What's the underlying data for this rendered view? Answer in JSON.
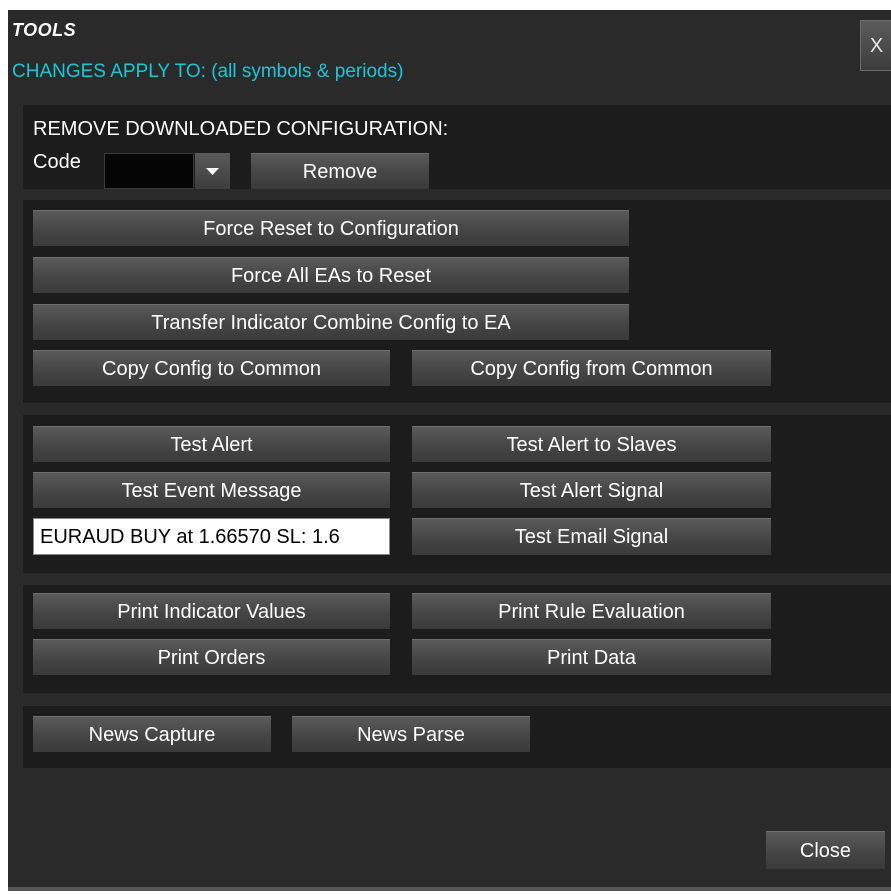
{
  "window": {
    "title": "TOOLS",
    "subtitle": "CHANGES APPLY TO: (all symbols & periods)",
    "close_x_label": "X",
    "close_label": "Close"
  },
  "remove_config": {
    "heading": "REMOVE DOWNLOADED CONFIGURATION:",
    "code_label": "Code",
    "code_value": "",
    "remove_label": "Remove"
  },
  "config_tools": {
    "force_reset_config": "Force Reset to Configuration",
    "force_all_eas_reset": "Force All EAs to Reset",
    "transfer_indicator": "Transfer Indicator Combine Config to EA",
    "copy_to_common": "Copy Config to Common",
    "copy_from_common": "Copy Config from Common"
  },
  "alert_tools": {
    "test_alert": "Test Alert",
    "test_alert_slaves": "Test Alert to Slaves",
    "test_event_message": "Test Event Message",
    "test_alert_signal": "Test Alert Signal",
    "message_value": "EURAUD BUY at 1.66570 SL: 1.6",
    "test_email_signal": "Test Email Signal"
  },
  "print_tools": {
    "print_indicator_values": "Print Indicator Values",
    "print_rule_evaluation": "Print Rule Evaluation",
    "print_orders": "Print Orders",
    "print_data": "Print Data"
  },
  "news_tools": {
    "news_capture": "News Capture",
    "news_parse": "News Parse"
  }
}
